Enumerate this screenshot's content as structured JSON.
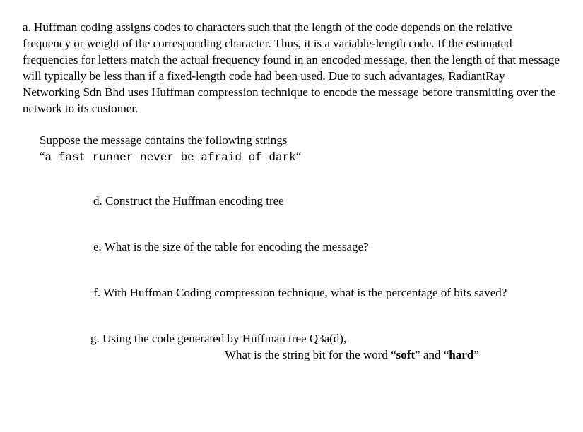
{
  "main_paragraph": "a. Huffman coding assigns codes to characters such that the length of the code depends on the relative frequency or weight of the corresponding character. Thus,  it is a variable-length code. If the estimated frequencies for letters match the actual frequency found in an encoded message, then the length of that message will  typically be less than if a fixed-length code had been used. Due to such advantages, RadiantRay Networking Sdn Bhd uses Huffman compression technique to encode  the message before transmitting over the network to its customer.",
  "suppose_line": "Suppose the message contains the following strings",
  "quote_open": "“",
  "code_text": "a fast runner never be afraid of dark",
  "quote_close": "“",
  "item_d": "d. Construct the Huffman encoding tree",
  "item_e": "e. What is the size of the table for encoding the message?",
  "item_f_prefix": " f.",
  "item_f_text": " With Huffman Coding compression technique, what is the percentage of bits saved?",
  "item_g_line1": "g. Using the code generated by Huffman tree Q3a(d),",
  "item_g_line2_prefix": "What is the string bit for the word “",
  "item_g_soft": "soft",
  "item_g_mid": "” and “",
  "item_g_hard": "hard",
  "item_g_end": "”"
}
